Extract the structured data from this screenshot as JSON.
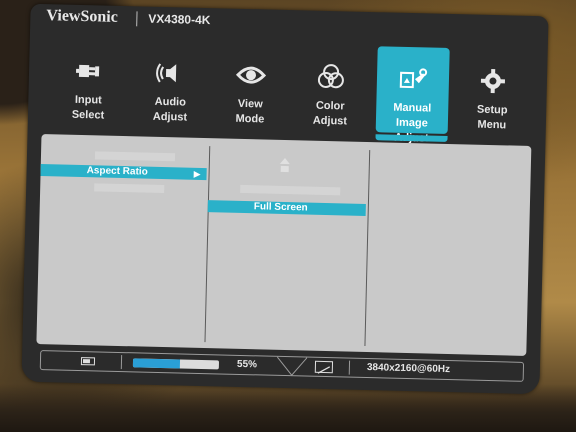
{
  "header": {
    "brand": "ViewSonic",
    "model": "VX4380-4K"
  },
  "top_menu": [
    {
      "label": "Input\nSelect",
      "icon": "input-plug-icon",
      "active": false
    },
    {
      "label": "Audio\nAdjust",
      "icon": "speaker-icon",
      "active": false
    },
    {
      "label": "View\nMode",
      "icon": "eye-icon",
      "active": false
    },
    {
      "label": "Color\nAdjust",
      "icon": "color-circles-icon",
      "active": false
    },
    {
      "label": "Manual Image\nAdjust",
      "icon": "manual-image-adjust-icon",
      "active": true
    },
    {
      "label": "Setup\nMenu",
      "icon": "gear-icon",
      "active": false
    }
  ],
  "submenu": {
    "selected_item": "Aspect Ratio",
    "selected_option": "Full Screen"
  },
  "status_bar": {
    "progress_label": "55%",
    "progress_value": 0.55,
    "resolution": "3840x2160@60Hz"
  },
  "colors": {
    "accent": "#2ab1c9",
    "panel": "#c9c9c9",
    "frame": "#2b2b2b",
    "progress": "#2a9fd6"
  }
}
